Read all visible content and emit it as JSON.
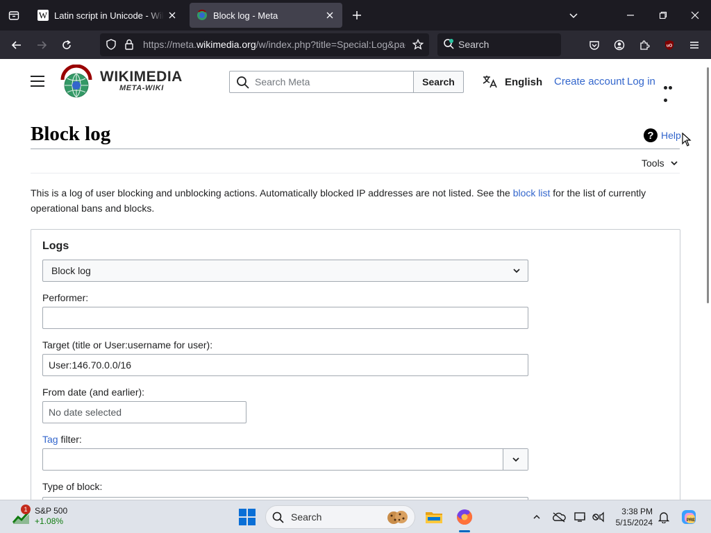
{
  "browser": {
    "tabs": [
      {
        "title": "Latin script in Unicode - Wikipe",
        "active": false,
        "favicon": "wikipedia-w-icon"
      },
      {
        "title": "Block log - Meta",
        "active": true,
        "favicon": "meta-wiki-icon"
      }
    ],
    "url_prefix": "https://meta.",
    "url_domain": "wikimedia.org",
    "url_suffix": "/w/index.php?title=Special:Log&page=",
    "search_placeholder": "Search"
  },
  "wiki_header": {
    "logo_title": "WIKIMEDIA",
    "logo_subtitle": "META-WIKI",
    "search_placeholder": "Search Meta",
    "search_button": "Search",
    "language": "English",
    "create_account": "Create account",
    "log_in": "Log in"
  },
  "page": {
    "title": "Block log",
    "help_label": "Help",
    "tools_label": "Tools",
    "intro_before": "This is a log of user blocking and unblocking actions. Automatically blocked IP addresses are not listed. See the ",
    "intro_link": "block list",
    "intro_after": " for the list of currently operational bans and blocks."
  },
  "form": {
    "legend": "Logs",
    "log_type_value": "Block log",
    "performer_label": "Performer:",
    "performer_value": "",
    "target_label": "Target (title or User:username for user):",
    "target_value": "User:146.70.0.0/16",
    "from_date_label": "From date (and earlier):",
    "from_date_placeholder": "No date selected",
    "tag_link": "Tag",
    "tag_label_suffix": " filter:",
    "type_of_block_label": "Type of block:"
  },
  "taskbar": {
    "stock_name": "S&P 500",
    "stock_change": "+1.08%",
    "stock_badge": "1",
    "search_placeholder": "Search",
    "time": "3:38 PM",
    "date": "5/15/2024"
  }
}
